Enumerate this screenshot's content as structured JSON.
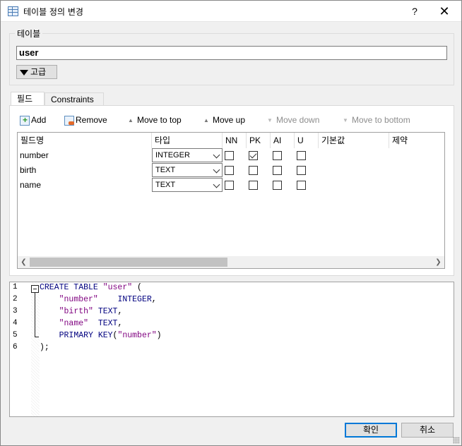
{
  "window": {
    "title": "테이블 정의 변경",
    "help_label": "?",
    "close_label": "✕"
  },
  "table_group": {
    "label": "테이블",
    "table_name": "user",
    "advanced_label": "고급"
  },
  "tabs": [
    {
      "label": "필드",
      "active": true
    },
    {
      "label": "Constraints",
      "active": false
    }
  ],
  "toolbar": {
    "add": "Add",
    "remove": "Remove",
    "move_to_top": "Move to top",
    "move_up": "Move up",
    "move_down": "Move down",
    "move_to_bottom": "Move to bottom"
  },
  "grid": {
    "columns": [
      "필드명",
      "타입",
      "NN",
      "PK",
      "AI",
      "U",
      "기본값",
      "제약"
    ],
    "rows": [
      {
        "name": "number",
        "type": "INTEGER",
        "nn": false,
        "pk": true,
        "ai": false,
        "u": false
      },
      {
        "name": "birth",
        "type": "TEXT",
        "nn": false,
        "pk": false,
        "ai": false,
        "u": false
      },
      {
        "name": "name",
        "type": "TEXT",
        "nn": false,
        "pk": false,
        "ai": false,
        "u": false
      }
    ]
  },
  "sql": {
    "line_numbers": [
      "1",
      "2",
      "3",
      "4",
      "5",
      "6"
    ],
    "lines": [
      [
        {
          "t": "CREATE TABLE ",
          "c": "kw"
        },
        {
          "t": "\"user\"",
          "c": "str"
        },
        {
          "t": " (",
          "c": ""
        }
      ],
      [
        {
          "t": "    ",
          "c": ""
        },
        {
          "t": "\"number\"",
          "c": "str"
        },
        {
          "t": "    ",
          "c": ""
        },
        {
          "t": "INTEGER",
          "c": "kw"
        },
        {
          "t": ",",
          "c": ""
        }
      ],
      [
        {
          "t": "    ",
          "c": ""
        },
        {
          "t": "\"birth\"",
          "c": "str"
        },
        {
          "t": " ",
          "c": ""
        },
        {
          "t": "TEXT",
          "c": "kw"
        },
        {
          "t": ",",
          "c": ""
        }
      ],
      [
        {
          "t": "    ",
          "c": ""
        },
        {
          "t": "\"name\"",
          "c": "str"
        },
        {
          "t": "  ",
          "c": ""
        },
        {
          "t": "TEXT",
          "c": "kw"
        },
        {
          "t": ",",
          "c": ""
        }
      ],
      [
        {
          "t": "    ",
          "c": ""
        },
        {
          "t": "PRIMARY KEY",
          "c": "kw"
        },
        {
          "t": "(",
          "c": ""
        },
        {
          "t": "\"number\"",
          "c": "str"
        },
        {
          "t": ")",
          "c": ""
        }
      ],
      [
        {
          "t": ");",
          "c": ""
        }
      ]
    ]
  },
  "buttons": {
    "ok": "확인",
    "cancel": "취소"
  },
  "colors": {
    "keyword": "#00007f",
    "string": "#7f007f",
    "default_button_border": "#0078d7"
  }
}
